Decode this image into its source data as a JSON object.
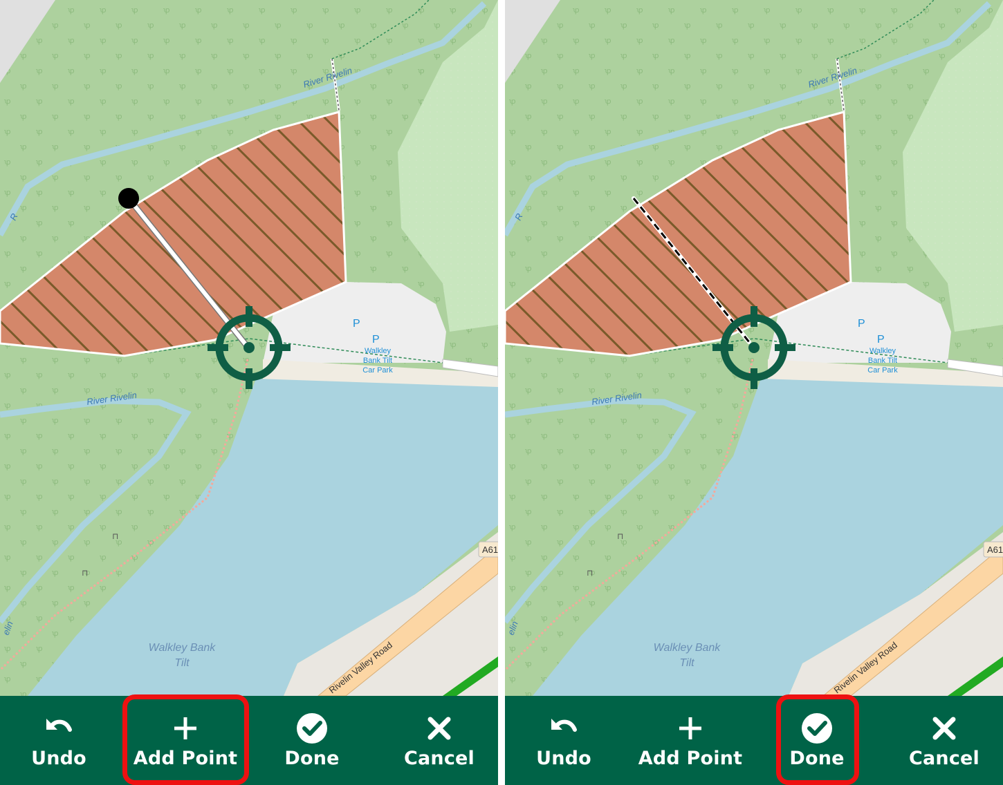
{
  "map": {
    "labels": {
      "river_top": "River Rivelin",
      "river_mid": "River Rivelin",
      "river_left_top": "R",
      "river_left_bottom": "elin",
      "parking_1": "P",
      "parking_2": "P",
      "car_park_line1": "Walkley",
      "car_park_line2": "Bank Tilt",
      "car_park_line3": "Car Park",
      "lake_line1": "Walkley Bank",
      "lake_line2": "Tilt",
      "road_name": "Rivelin Valley Road",
      "road_ref": "A61"
    },
    "colors": {
      "woodland": "#add19e",
      "water": "#aad3df",
      "polygon_fill": "#d4876a",
      "polygon_hatch": "#7a5a2a",
      "crosshair": "#0f5e45",
      "road_fill": "#fcd6a4"
    }
  },
  "toolbar": {
    "background": "#006347",
    "buttons": [
      {
        "label": "Undo",
        "icon": "undo-icon"
      },
      {
        "label": "Add Point",
        "icon": "plus-icon"
      },
      {
        "label": "Done",
        "icon": "check-circle-icon"
      },
      {
        "label": "Cancel",
        "icon": "close-icon"
      }
    ]
  },
  "panels": [
    {
      "step": "left",
      "highlighted_button": "Add Point"
    },
    {
      "step": "right",
      "highlighted_button": "Done"
    }
  ],
  "highlight_color": "#ee1111"
}
